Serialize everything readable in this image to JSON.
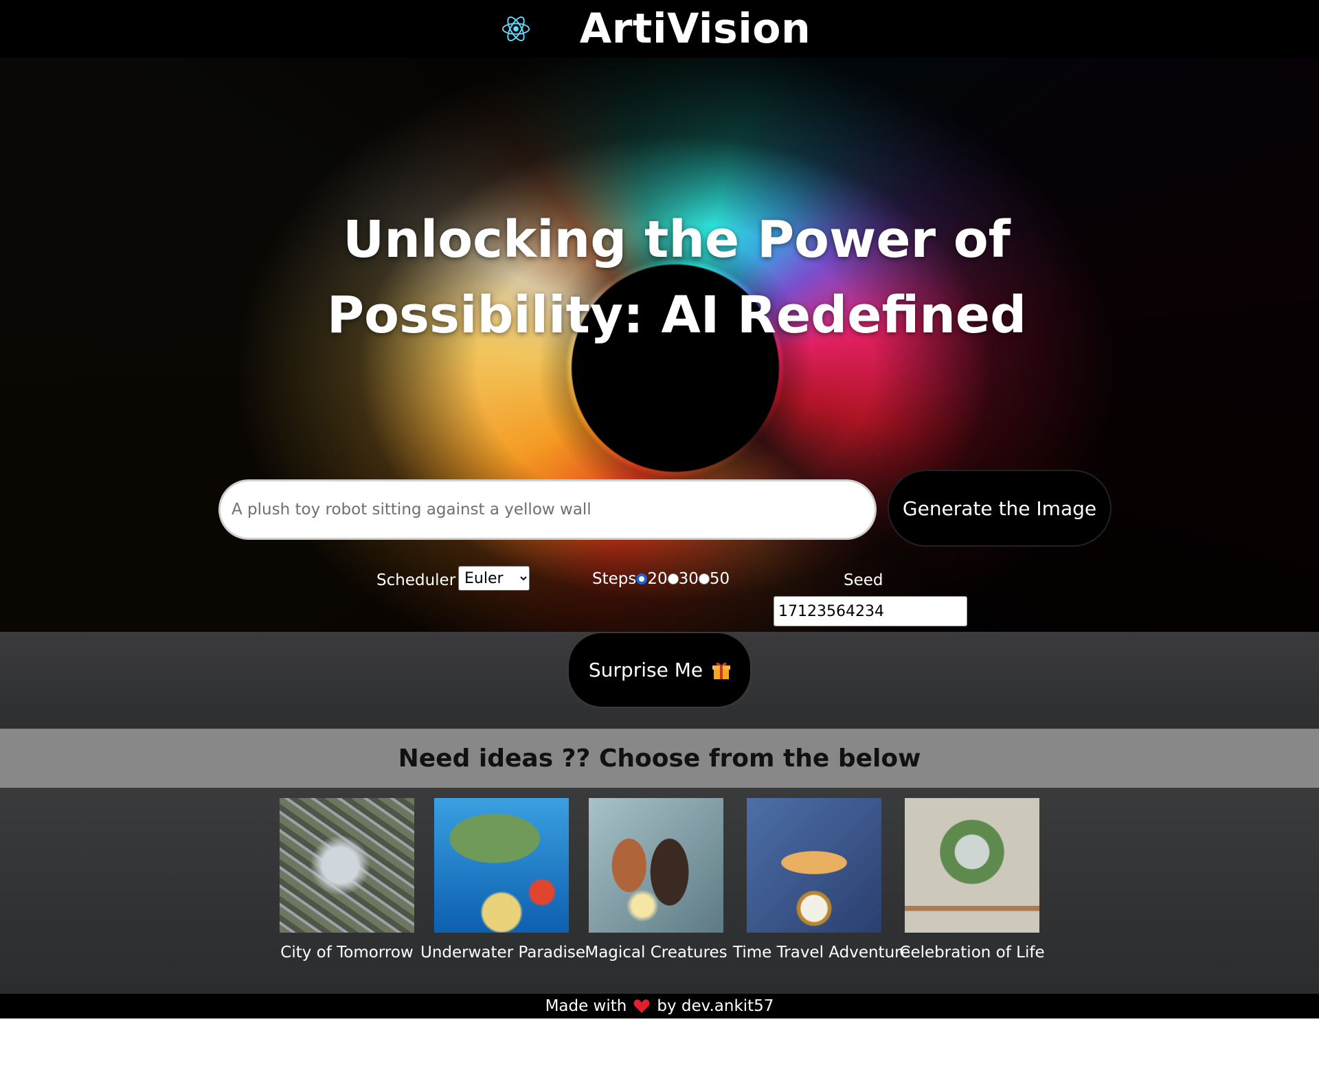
{
  "header": {
    "title": "ArtiVision",
    "logo_icon": "react-atom-icon"
  },
  "hero": {
    "title": "Unlocking the Power of Possibility: AI Redefined",
    "prompt_placeholder": "A plush toy robot sitting against a yellow wall",
    "generate_label": "Generate the Image"
  },
  "controls": {
    "scheduler_label": "Scheduler",
    "scheduler_value": "Euler",
    "steps_label": "Steps",
    "steps_options": [
      "20",
      "30",
      "50"
    ],
    "steps_selected": "20",
    "seed_label": "Seed",
    "seed_value": "17123564234"
  },
  "surprise": {
    "label": "Surprise Me",
    "icon": "gift-icon"
  },
  "ideas": {
    "heading": "Need ideas ?? Choose from the below",
    "items": [
      {
        "label": "City of Tomorrow"
      },
      {
        "label": "Underwater Paradise"
      },
      {
        "label": "Magical Creatures"
      },
      {
        "label": "Time Travel Adventure"
      },
      {
        "label": "Celebration of Life"
      }
    ]
  },
  "footer": {
    "prefix": "Made with",
    "suffix": "by dev.ankit57",
    "icon": "heart-icon"
  },
  "colors": {
    "accent": "#61dafb",
    "radio_checked": "#1a66d9",
    "heart": "#e0202a",
    "gift": "#f5a623"
  }
}
